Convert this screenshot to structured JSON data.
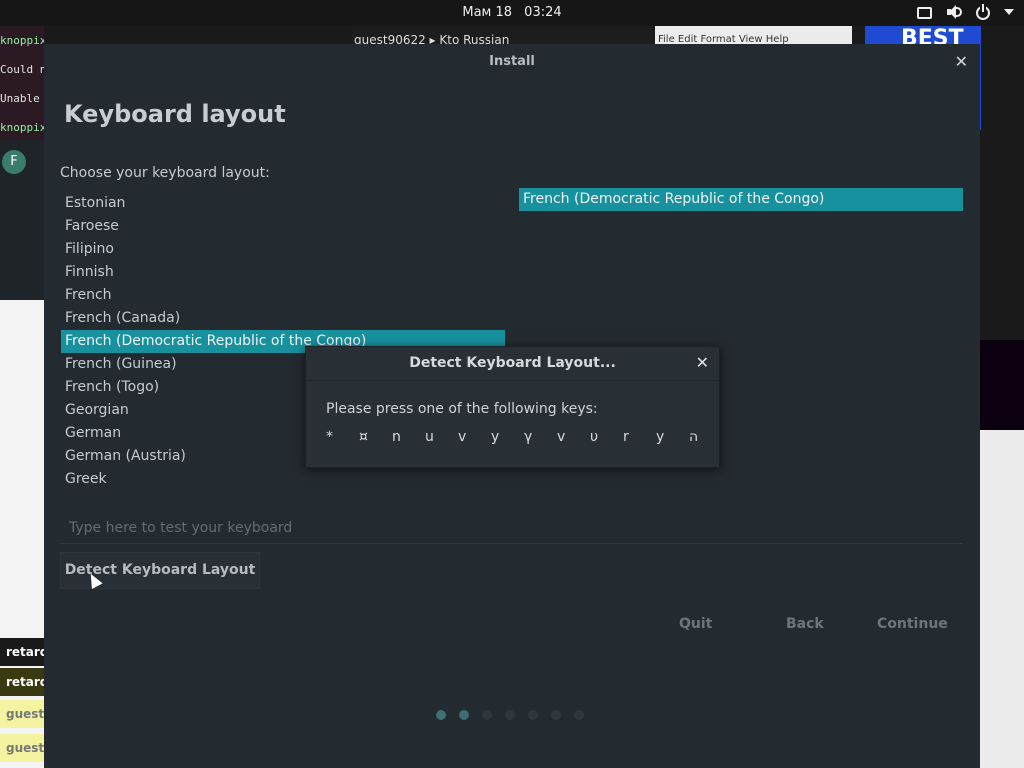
{
  "topbar": {
    "date": "Мам 18",
    "time": "03:24",
    "icons": [
      "keyboard-icon",
      "volume-icon",
      "power-icon",
      "caret-down-icon"
    ]
  },
  "background": {
    "terminal_lines": [
      "knoppix@tk",
      "Could not",
      "Unable t",
      "knoppix@tk"
    ],
    "chat_avatar": "F",
    "top_strip": "guest90622 ▸  Kto Russian",
    "menu": "File  Edit  Format  View  Help",
    "banner": "BEST",
    "side_labels": [
      "retard",
      "retard",
      "guest",
      "guest"
    ]
  },
  "window": {
    "title": "Install",
    "page_title": "Keyboard layout",
    "prompt": "Choose your keyboard layout:",
    "layouts": [
      {
        "label": "Estonian",
        "selected": false
      },
      {
        "label": "Faroese",
        "selected": false
      },
      {
        "label": "Filipino",
        "selected": false
      },
      {
        "label": "Finnish",
        "selected": false
      },
      {
        "label": "French",
        "selected": false
      },
      {
        "label": "French (Canada)",
        "selected": false
      },
      {
        "label": "French (Democratic Republic of the Congo)",
        "selected": true
      },
      {
        "label": "French (Guinea)",
        "selected": false
      },
      {
        "label": "French (Togo)",
        "selected": false
      },
      {
        "label": "Georgian",
        "selected": false
      },
      {
        "label": "German",
        "selected": false
      },
      {
        "label": "German (Austria)",
        "selected": false
      },
      {
        "label": "Greek",
        "selected": false
      }
    ],
    "variants": [
      {
        "label": "French (Democratic Republic of the Congo)",
        "selected": true
      }
    ],
    "test_placeholder": "Type here to test your keyboard",
    "detect_button": "Detect Keyboard Layout",
    "quit": "Quit",
    "back": "Back",
    "continue": "Continue",
    "progress": {
      "total_steps": 7,
      "current_step": 2
    }
  },
  "dialog": {
    "title": "Detect Keyboard Layout...",
    "text": "Please press one of the following keys:",
    "keys": [
      "*",
      "¤",
      "n",
      "u",
      "v",
      "y",
      "γ",
      "v",
      "υ",
      "r",
      "y",
      "ה"
    ]
  },
  "colors": {
    "selection": "#17919e",
    "window_bg": "#232a30"
  }
}
